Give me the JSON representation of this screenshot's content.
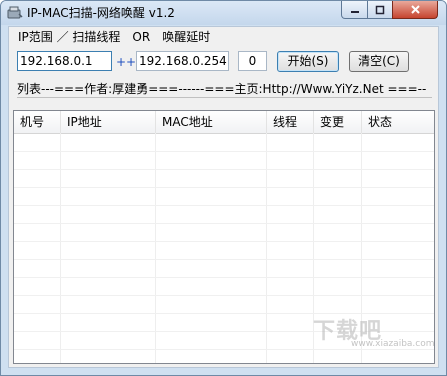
{
  "window": {
    "title": "IP-MAC扫描-网络唤醒 v1.2"
  },
  "settings": {
    "range_label": "IP范围 ／ 扫描线程　OR　唤醒延时",
    "ip_start": "192.168.0.1",
    "separator": "++>",
    "ip_end": "192.168.0.254",
    "threads": "0",
    "start_button": "开始(S)",
    "clear_button": "清空(C)"
  },
  "info_line": "列表---===作者:厚建勇===------===主页:Http://Www.YiYz.Net ===--",
  "table": {
    "columns": [
      "机号",
      "IP地址",
      "MAC地址",
      "线程",
      "变更",
      "状态"
    ],
    "rows": []
  },
  "watermark": {
    "text": "下载吧",
    "sub": "www.xiazaiba.com"
  }
}
